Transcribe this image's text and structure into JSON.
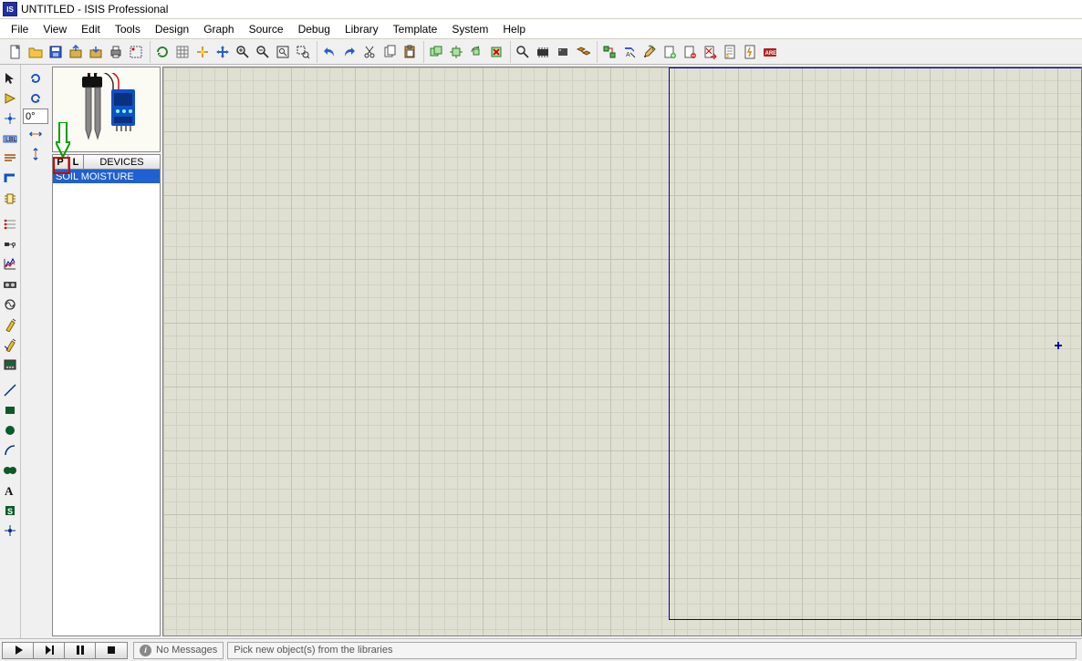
{
  "title": "UNTITLED - ISIS Professional",
  "logo_text": "ISIS",
  "menu": [
    "File",
    "View",
    "Edit",
    "Tools",
    "Design",
    "Graph",
    "Source",
    "Debug",
    "Library",
    "Template",
    "System",
    "Help"
  ],
  "rotation_value": "0°",
  "devices_header": "DEVICES",
  "p_button": "P",
  "l_button": "L",
  "device_list": [
    "SOIL MOISTURE"
  ],
  "status_no_messages": "No Messages",
  "status_hint": "Pick new object(s) from the libraries",
  "toolbar_main": [
    {
      "name": "new-file-icon"
    },
    {
      "name": "open-file-icon"
    },
    {
      "name": "save-file-icon"
    },
    {
      "name": "import-icon"
    },
    {
      "name": "export-icon"
    },
    {
      "name": "print-icon"
    },
    {
      "name": "set-area-icon"
    }
  ],
  "toolbar_view": [
    {
      "name": "refresh-icon"
    },
    {
      "name": "toggle-grid-icon"
    },
    {
      "name": "origin-icon"
    },
    {
      "name": "pan-icon"
    },
    {
      "name": "zoom-in-icon"
    },
    {
      "name": "zoom-out-icon"
    },
    {
      "name": "zoom-fit-icon"
    },
    {
      "name": "zoom-area-icon"
    }
  ],
  "toolbar_edit": [
    {
      "name": "undo-icon"
    },
    {
      "name": "redo-icon"
    },
    {
      "name": "cut-icon"
    },
    {
      "name": "copy-icon"
    },
    {
      "name": "paste-icon"
    }
  ],
  "toolbar_block": [
    {
      "name": "block-copy-icon"
    },
    {
      "name": "block-move-icon"
    },
    {
      "name": "block-rotate-icon"
    },
    {
      "name": "block-delete-icon"
    }
  ],
  "toolbar_lib": [
    {
      "name": "pick-device-icon"
    },
    {
      "name": "make-device-icon"
    },
    {
      "name": "packaging-icon"
    },
    {
      "name": "decompose-icon"
    }
  ],
  "toolbar_design": [
    {
      "name": "wire-autorouter-icon"
    },
    {
      "name": "search-tag-icon"
    },
    {
      "name": "property-icon"
    },
    {
      "name": "new-sheet-icon"
    },
    {
      "name": "remove-sheet-icon"
    },
    {
      "name": "exit-to-parent-icon"
    },
    {
      "name": "bill-of-materials-icon"
    },
    {
      "name": "electrical-check-icon"
    },
    {
      "name": "netlist-ares-icon"
    }
  ],
  "left_tools": [
    "selection-arrow-icon",
    "component-icon",
    "junction-icon",
    "wire-label-icon",
    "text-script-icon",
    "bus-icon",
    "subcircuit-icon",
    "terminals-icon",
    "device-pins-icon",
    "graph-icon",
    "tape-icon",
    "generator-icon",
    "voltage-probe-icon",
    "current-probe-icon",
    "virtual-instrument-icon",
    "line-2d-icon",
    "box-2d-icon",
    "circle-2d-icon",
    "arc-2d-icon",
    "path-2d-icon",
    "text-2d-icon",
    "symbol-icon",
    "marker-icon"
  ],
  "rot_tools": [
    "rotate-cw-icon",
    "rotate-ccw-icon",
    "mirror-x-icon",
    "mirror-y-icon"
  ],
  "sim_buttons": [
    "play-icon",
    "step-icon",
    "pause-icon",
    "stop-icon"
  ]
}
